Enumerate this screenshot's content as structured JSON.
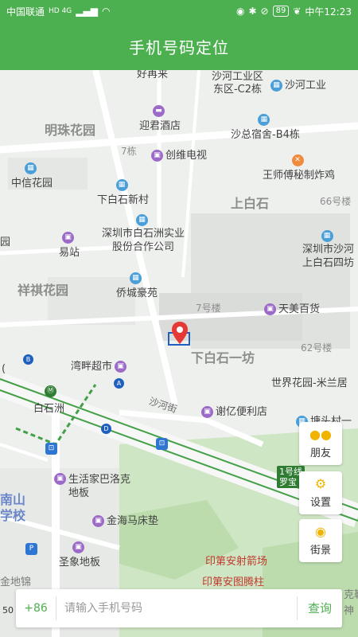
{
  "status_bar": {
    "carrier": "中国联通",
    "network": "HD 4G",
    "battery": "89",
    "time": "中午12:23"
  },
  "app_bar": {
    "title": "手机号码定位"
  },
  "map": {
    "labels": {
      "haoxiangmi": "好再来",
      "shahe_c2": "沙河工业区\n东区-C2栋",
      "shahe_right": "沙河工业",
      "mingzhu": "明珠花园",
      "yingjun": "迎君酒店",
      "shazong": "沙总宿舍-B4栋",
      "dong7": "7栋",
      "chuangwei": "创维电视",
      "wangshi": "王师傅秘制炸鸡",
      "zhongxin": "中信花园",
      "xiabaishi_xc": "下白石新村",
      "shangbaishi": "上白石",
      "dong66": "66号楼",
      "shenzhen_bsz": "深圳市白石洲实业\n股份合作公司",
      "shenzhen_sh": "深圳市沙河\n上白石四坊",
      "yuan_left": "园",
      "yizhan": "易站",
      "xiangqi": "祥祺花园",
      "qiaocheng": "侨城豪苑",
      "lou7": "7号楼",
      "tianmei": "天美百货",
      "xiabaishi_1f": "下白石一坊",
      "lou62": "62号楼",
      "wanpan": "湾畔超市",
      "shijie": "世界花园-米兰居",
      "baishizhou": "白石洲",
      "shahejie": "沙河街",
      "xieyi": "谢亿便利店",
      "tangtou": "塘头村一",
      "shenghuo": "生活家巴洛克\n地板",
      "jinhai": "金海马床垫",
      "nanshan": "南山\n学校",
      "shengxiang": "圣象地板",
      "luobao": "1号线\n罗宝",
      "yindi_sf": "印第安射箭场",
      "yindi_tt": "印第安图腾柱",
      "jindijin": "金地锦",
      "kele": "克勒",
      "shen": "神",
      "left_h": "(",
      "scale": "50"
    },
    "badges": {
      "b": "B",
      "a": "A",
      "d": "D"
    }
  },
  "side_buttons": {
    "friends": "朋友",
    "settings": "设置",
    "street": "街景"
  },
  "search": {
    "country_code": "+86",
    "placeholder": "请输入手机号码",
    "query": "查询"
  }
}
